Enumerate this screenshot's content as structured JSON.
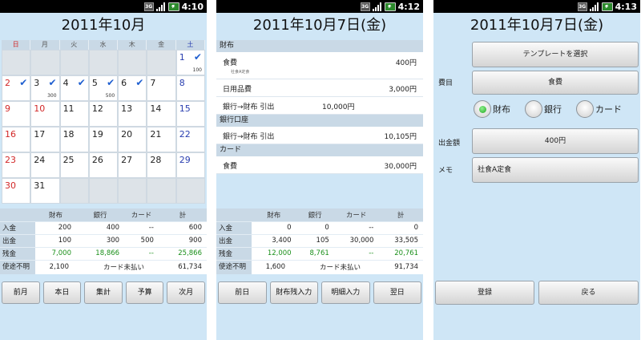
{
  "status": {
    "s1_time": "4:10",
    "s2_time": "4:12",
    "s3_time": "4:13",
    "data_label": "3G"
  },
  "calendar": {
    "title": "2011年10月",
    "weekdays": [
      "日",
      "月",
      "火",
      "水",
      "木",
      "金",
      "土"
    ],
    "cells": [
      {
        "d": "",
        "c": "",
        "chk": false,
        "amt": ""
      },
      {
        "d": "",
        "c": "",
        "chk": false,
        "amt": ""
      },
      {
        "d": "",
        "c": "",
        "chk": false,
        "amt": ""
      },
      {
        "d": "",
        "c": "",
        "chk": false,
        "amt": ""
      },
      {
        "d": "",
        "c": "",
        "chk": false,
        "amt": ""
      },
      {
        "d": "",
        "c": "",
        "chk": false,
        "amt": ""
      },
      {
        "d": "1",
        "c": "blue",
        "chk": true,
        "amt": "100"
      },
      {
        "d": "2",
        "c": "red",
        "chk": true,
        "amt": ""
      },
      {
        "d": "3",
        "c": "",
        "chk": true,
        "amt": "300"
      },
      {
        "d": "4",
        "c": "",
        "chk": true,
        "amt": ""
      },
      {
        "d": "5",
        "c": "",
        "chk": true,
        "amt": "500"
      },
      {
        "d": "6",
        "c": "",
        "chk": true,
        "amt": ""
      },
      {
        "d": "7",
        "c": "",
        "chk": false,
        "amt": ""
      },
      {
        "d": "8",
        "c": "blue",
        "chk": false,
        "amt": ""
      },
      {
        "d": "9",
        "c": "red",
        "chk": false,
        "amt": ""
      },
      {
        "d": "10",
        "c": "red",
        "chk": false,
        "amt": ""
      },
      {
        "d": "11",
        "c": "",
        "chk": false,
        "amt": ""
      },
      {
        "d": "12",
        "c": "",
        "chk": false,
        "amt": ""
      },
      {
        "d": "13",
        "c": "",
        "chk": false,
        "amt": ""
      },
      {
        "d": "14",
        "c": "",
        "chk": false,
        "amt": ""
      },
      {
        "d": "15",
        "c": "blue",
        "chk": false,
        "amt": ""
      },
      {
        "d": "16",
        "c": "red",
        "chk": false,
        "amt": ""
      },
      {
        "d": "17",
        "c": "",
        "chk": false,
        "amt": ""
      },
      {
        "d": "18",
        "c": "",
        "chk": false,
        "amt": ""
      },
      {
        "d": "19",
        "c": "",
        "chk": false,
        "amt": ""
      },
      {
        "d": "20",
        "c": "",
        "chk": false,
        "amt": ""
      },
      {
        "d": "21",
        "c": "",
        "chk": false,
        "amt": ""
      },
      {
        "d": "22",
        "c": "blue",
        "chk": false,
        "amt": ""
      },
      {
        "d": "23",
        "c": "red",
        "chk": false,
        "amt": ""
      },
      {
        "d": "24",
        "c": "",
        "chk": false,
        "amt": ""
      },
      {
        "d": "25",
        "c": "",
        "chk": false,
        "amt": ""
      },
      {
        "d": "26",
        "c": "",
        "chk": false,
        "amt": ""
      },
      {
        "d": "27",
        "c": "",
        "chk": false,
        "amt": ""
      },
      {
        "d": "28",
        "c": "",
        "chk": false,
        "amt": ""
      },
      {
        "d": "29",
        "c": "blue",
        "chk": false,
        "amt": ""
      },
      {
        "d": "30",
        "c": "red",
        "chk": false,
        "amt": ""
      },
      {
        "d": "31",
        "c": "",
        "chk": false,
        "amt": ""
      },
      {
        "d": "",
        "c": "",
        "chk": false,
        "amt": ""
      },
      {
        "d": "",
        "c": "",
        "chk": false,
        "amt": ""
      },
      {
        "d": "",
        "c": "",
        "chk": false,
        "amt": ""
      },
      {
        "d": "",
        "c": "",
        "chk": false,
        "amt": ""
      },
      {
        "d": "",
        "c": "",
        "chk": false,
        "amt": ""
      }
    ]
  },
  "summary_headers": [
    "財布",
    "銀行",
    "カード",
    "計"
  ],
  "summary1": {
    "rows": [
      {
        "label": "入金",
        "vals": [
          "200",
          "400",
          "--",
          "600"
        ]
      },
      {
        "label": "出金",
        "vals": [
          "100",
          "300",
          "500",
          "900"
        ]
      },
      {
        "label": "残金",
        "vals": [
          "7,000",
          "18,866",
          "--",
          "25,866"
        ]
      }
    ],
    "unknown_label": "使途不明",
    "unknown_value": "2,100",
    "card_label": "カード未払い",
    "card_value": "61,734"
  },
  "buttons1": [
    "前月",
    "本日",
    "集計",
    "予算",
    "次月"
  ],
  "day": {
    "title": "2011年10月7日(金)",
    "sections": [
      {
        "name": "財布",
        "items": [
          {
            "name": "食費",
            "memo": "社食A定食",
            "mid": "",
            "amount": "400円"
          },
          {
            "name": "日用品費",
            "memo": "",
            "mid": "",
            "amount": "3,000円"
          },
          {
            "name": "銀行→財布 引出",
            "memo": "",
            "mid": "10,000円",
            "amount": ""
          }
        ]
      },
      {
        "name": "銀行口座",
        "items": [
          {
            "name": "銀行→財布 引出",
            "memo": "",
            "mid": "",
            "amount": "10,105円"
          }
        ]
      },
      {
        "name": "カード",
        "items": [
          {
            "name": "食費",
            "memo": "",
            "mid": "",
            "amount": "30,000円"
          }
        ]
      }
    ]
  },
  "summary2": {
    "rows": [
      {
        "label": "入金",
        "vals": [
          "0",
          "0",
          "--",
          "0"
        ]
      },
      {
        "label": "出金",
        "vals": [
          "3,400",
          "105",
          "30,000",
          "33,505"
        ]
      },
      {
        "label": "残金",
        "vals": [
          "12,000",
          "8,761",
          "--",
          "20,761"
        ]
      }
    ],
    "unknown_label": "使途不明",
    "unknown_value": "1,600",
    "card_label": "カード未払い",
    "card_value": "91,734"
  },
  "buttons2": [
    "前日",
    "財布残入力",
    "明細入力",
    "翌日"
  ],
  "form": {
    "title": "2011年10月7日(金)",
    "template_button": "テンプレートを選択",
    "category_label": "費目",
    "category_value": "食費",
    "radios": [
      "財布",
      "銀行",
      "カード"
    ],
    "amount_label": "出金額",
    "amount_value": "400円",
    "memo_label": "メモ",
    "memo_value": "社食A定食",
    "register_button": "登録",
    "back_button": "戻る"
  },
  "colors": {
    "screen_bg": "#cfe6f6",
    "header_bg": "#c9d9e6",
    "weekend_red": "#d22828",
    "saturday_blue": "#2a3fb0",
    "check_blue": "#1f5fd0",
    "balance_green": "#1a8f1a"
  }
}
